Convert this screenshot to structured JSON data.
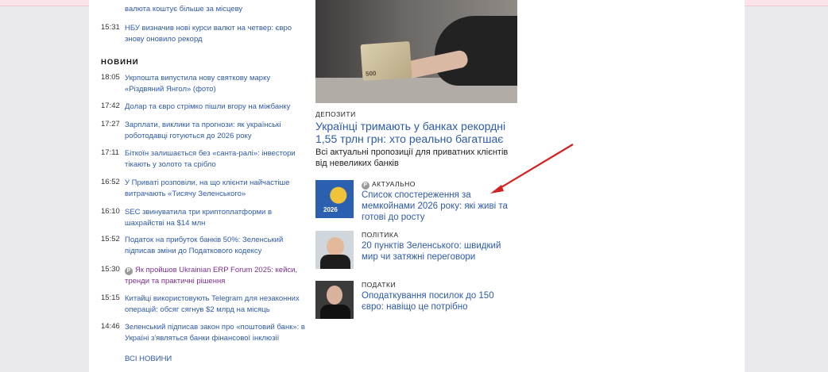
{
  "left_top": [
    {
      "time": "",
      "text": "валюта коштує більше за місцеву"
    },
    {
      "time": "15:31",
      "text": "НБУ визначив нові курси валют на четвер: євро знову оновило рекорд"
    }
  ],
  "news": {
    "section_title": "НОВИНИ",
    "items": [
      {
        "time": "18:05",
        "text": "Укрпошта випустила нову святкову марку «Різдвяний Янгол» (фото)"
      },
      {
        "time": "17:42",
        "text": "Долар та євро стрімко пішли вгору на міжбанку"
      },
      {
        "time": "17:27",
        "text": "Зарплати, виклики та прогнози: як українські роботодавці готуються до 2026 року"
      },
      {
        "time": "17:11",
        "text": "Біткоїн залишається без «санта-ралі»: інвестори тікають у золото та срібло"
      },
      {
        "time": "16:52",
        "text": "У Привaті розповіли, на що клієнти найчастіше витрачають «Тисячу Зеленського»"
      },
      {
        "time": "16:10",
        "text": "SEC звинуватила три криптоплатформи в шахрайстві на $14 млн"
      },
      {
        "time": "15:52",
        "text": "Податок на прибуток банків 50%: Зеленський підписав зміни до Податкового кодексу"
      },
      {
        "time": "15:30",
        "badge": "P",
        "text": "Як пройшов Ukrainian ERP Forum 2025: кейси, тренди та практичні рішення"
      },
      {
        "time": "15:15",
        "text": "Китайці використовують Telegram для незаконних операцій: обсяг сягнув $2 млрд на місяць"
      },
      {
        "time": "14:46",
        "text": "Зеленський підписав закон про «поштовий банк»: в Україні з'являться банки фінансової інклюзії"
      }
    ],
    "all_news_label": "ВСІ НОВИНИ"
  },
  "main": {
    "hero_banknote_label": "500",
    "category": "ДЕПОЗИТИ",
    "headline": "Українці тримають у банках рекордні 1,55 трлн грн: хто реально багатшає",
    "lead": "Всі актуальні пропозиції для приватних клієнтів від невеликих банків",
    "cards": [
      {
        "badge": "P",
        "category": "АКТУАЛЬНО",
        "title": "Список спостереження за мемкойнами 2026 року: які живі та готові до росту",
        "thumb_label": "2026"
      },
      {
        "category": "ПОЛІТИКА",
        "title": "20 пунктів Зеленського: швидкий мир чи затяжні переговори"
      },
      {
        "category": "ПОДАТКИ",
        "title": "Оподаткування посилок до 150 євро: навіщо це потрібно"
      }
    ]
  },
  "colors": {
    "link": "#2e5aa8",
    "arrow": "#d32020",
    "promo_link": "#7b2f8e"
  }
}
